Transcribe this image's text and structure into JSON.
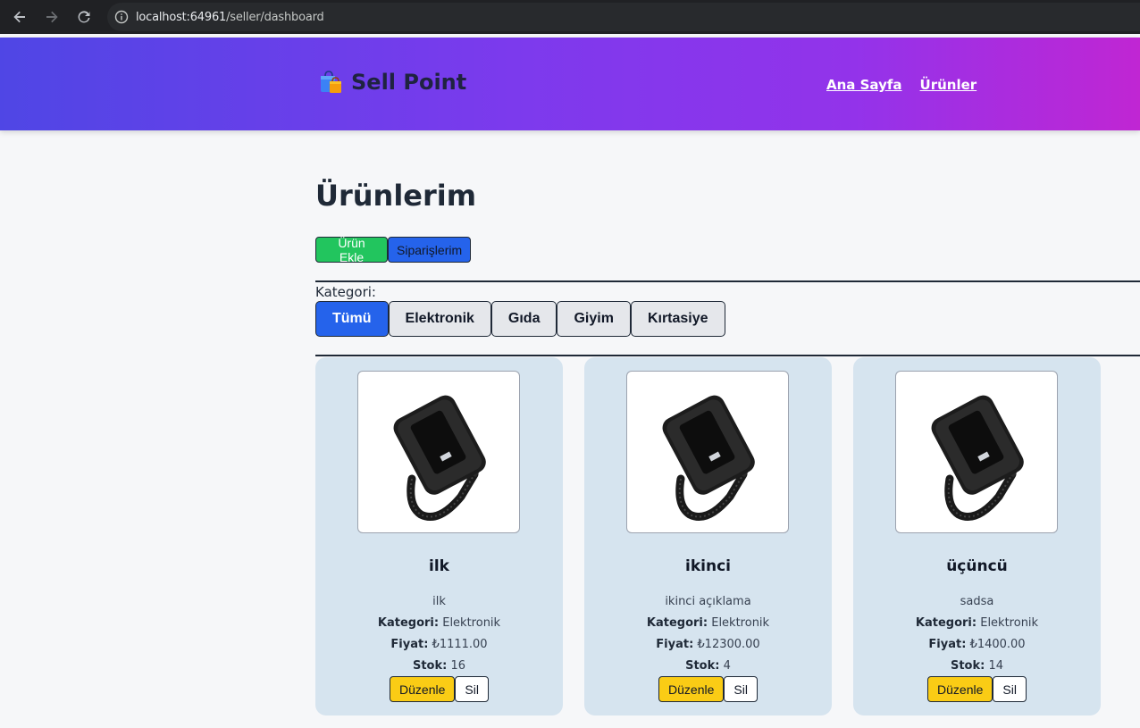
{
  "browser": {
    "url_host": "localhost:64961",
    "url_path": "/seller/dashboard"
  },
  "header": {
    "brand": "Sell Point",
    "nav": [
      "Ana Sayfa",
      "Ürünler"
    ]
  },
  "main": {
    "title": "Ürünlerim",
    "add_button": "Ürün Ekle",
    "orders_button": "Siparişlerim",
    "category_label": "Kategori:",
    "categories": [
      "Tümü",
      "Elektronik",
      "Gıda",
      "Giyim",
      "Kırtasiye"
    ],
    "active_category": "Tümü"
  },
  "labels": {
    "category": "Kategori:",
    "price": "Fiyat:",
    "stock": "Stok:",
    "edit": "Düzenle",
    "delete": "Sil"
  },
  "products": [
    {
      "name": "ilk",
      "description": "ilk",
      "category": "Elektronik",
      "price": "₺1111.00",
      "stock": "16"
    },
    {
      "name": "ikinci",
      "description": "ikinci açıklama",
      "category": "Elektronik",
      "price": "₺12300.00",
      "stock": "4"
    },
    {
      "name": "üçüncü",
      "description": "sadsa",
      "category": "Elektronik",
      "price": "₺1400.00",
      "stock": "14"
    }
  ],
  "colors": {
    "header_gradient_start": "#4f46e5",
    "header_gradient_end": "#c026d3",
    "primary": "#2563eb",
    "success": "#22c55e",
    "warning": "#facc15",
    "card_bg": "#d6e4ef"
  }
}
